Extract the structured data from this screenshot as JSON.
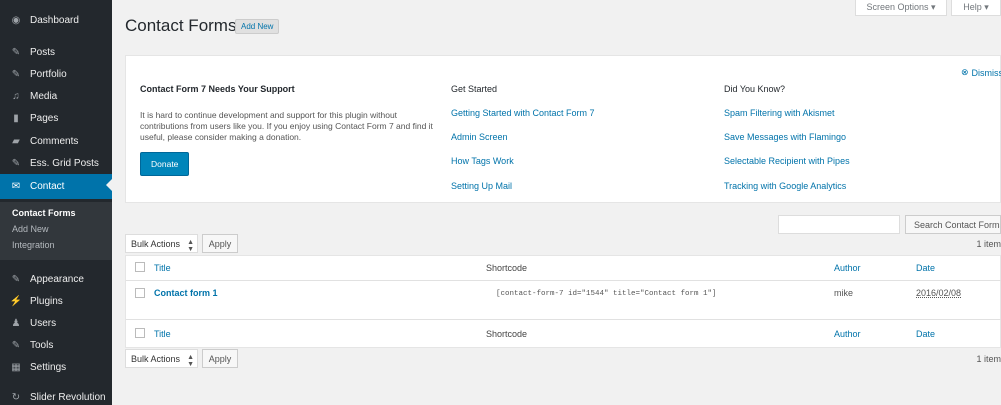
{
  "sidebar": {
    "items": [
      {
        "label": "Dashboard",
        "icon": "dashboard-icon",
        "glyph": "◉"
      },
      {
        "label": "Posts",
        "icon": "pin-icon",
        "glyph": "✎"
      },
      {
        "label": "Portfolio",
        "icon": "pin-icon",
        "glyph": "✎"
      },
      {
        "label": "Media",
        "icon": "media-icon",
        "glyph": "♫"
      },
      {
        "label": "Pages",
        "icon": "pages-icon",
        "glyph": "▮"
      },
      {
        "label": "Comments",
        "icon": "comments-icon",
        "glyph": "▰"
      },
      {
        "label": "Ess. Grid Posts",
        "icon": "pin-icon",
        "glyph": "✎"
      },
      {
        "label": "Contact",
        "icon": "mail-icon",
        "glyph": "✉"
      },
      {
        "label": "Appearance",
        "icon": "brush-icon",
        "glyph": "✎"
      },
      {
        "label": "Plugins",
        "icon": "plugin-icon",
        "glyph": "⚡"
      },
      {
        "label": "Users",
        "icon": "users-icon",
        "glyph": "♟"
      },
      {
        "label": "Tools",
        "icon": "wrench-icon",
        "glyph": "✎"
      },
      {
        "label": "Settings",
        "icon": "settings-icon",
        "glyph": "▦"
      },
      {
        "label": "Slider Revolution",
        "icon": "refresh-icon",
        "glyph": "↻"
      }
    ],
    "submenu": [
      "Contact Forms",
      "Add New",
      "Integration"
    ]
  },
  "header": {
    "title": "Contact Forms",
    "add_new": "Add New",
    "screen_options": "Screen Options ▾",
    "help": "Help ▾"
  },
  "welcome": {
    "dismiss": "Dismiss",
    "support_title": "Contact Form 7 Needs Your Support",
    "support_text": "It is hard to continue development and support for this plugin without contributions from users like you. If you enjoy using Contact Form 7 and find it useful, please consider making a donation.",
    "donate": "Donate",
    "get_started_title": "Get Started",
    "get_started_links": [
      "Getting Started with Contact Form 7",
      "Admin Screen",
      "How Tags Work",
      "Setting Up Mail"
    ],
    "did_you_know_title": "Did You Know?",
    "did_you_know_links": [
      "Spam Filtering with Akismet",
      "Save Messages with Flamingo",
      "Selectable Recipient with Pipes",
      "Tracking with Google Analytics"
    ]
  },
  "search": {
    "placeholder": "",
    "button": "Search Contact Forms"
  },
  "bulk": {
    "label": "Bulk Actions",
    "apply": "Apply",
    "items_count": "1 item"
  },
  "table": {
    "columns": {
      "title": "Title",
      "shortcode": "Shortcode",
      "author": "Author",
      "date": "Date"
    },
    "rows": [
      {
        "title": "Contact form 1",
        "shortcode": "[contact-form-7 id=\"1544\" title=\"Contact form 1\"]",
        "author": "mike",
        "date": "2016/02/08"
      }
    ]
  },
  "colors": {
    "sidebar_bg": "#23282d",
    "accent": "#0073aa",
    "donate": "#0085ba"
  }
}
